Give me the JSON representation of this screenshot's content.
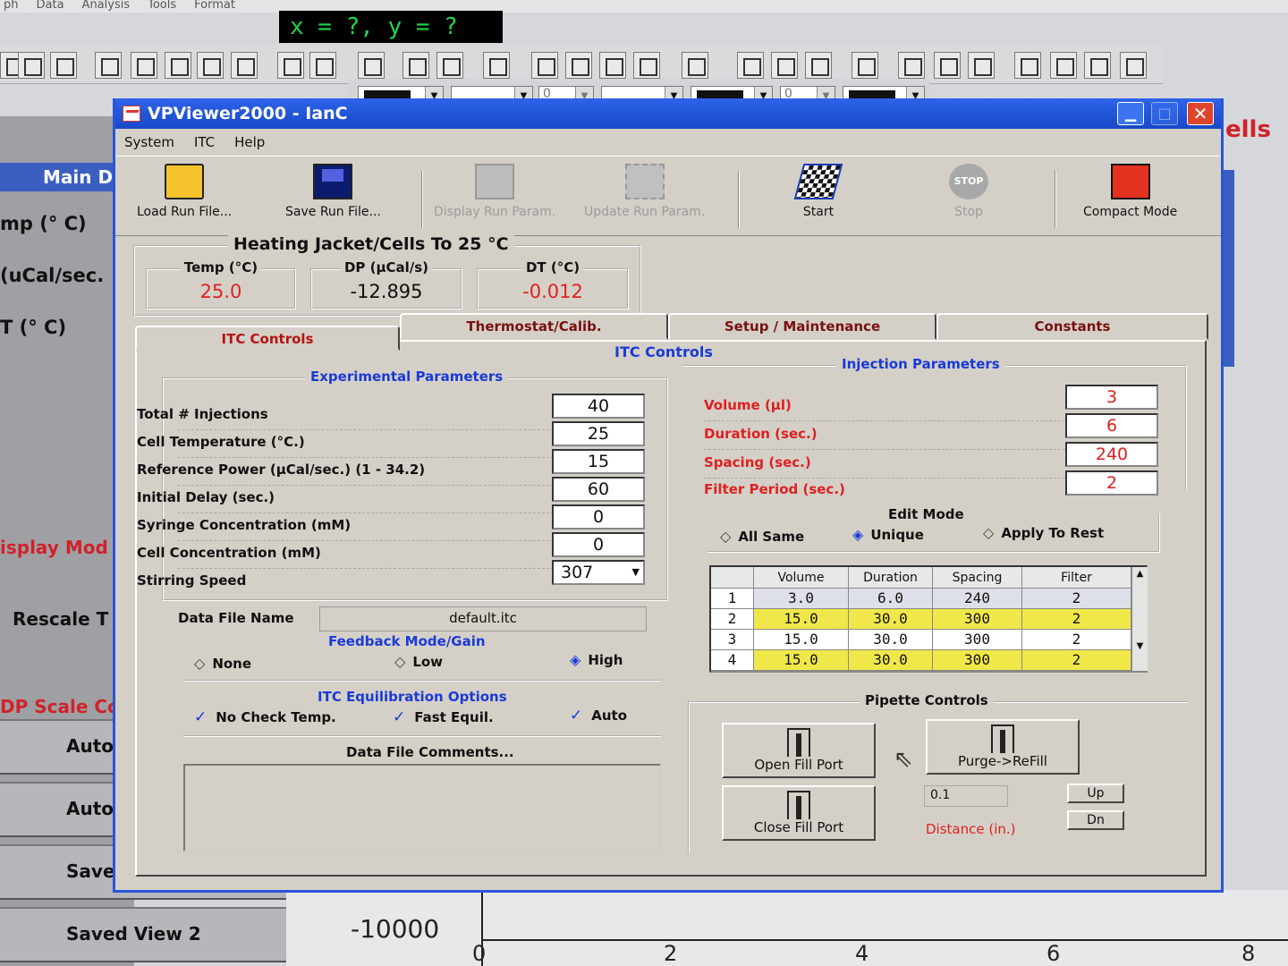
{
  "background": {
    "menu": [
      "ph",
      "Data",
      "Analysis",
      "Tools",
      "Format"
    ],
    "readout": "x = ?, y = ?",
    "side": {
      "header": "Main D",
      "labels": [
        "mp (° C)",
        "(uCal/sec.",
        "T (° C)"
      ],
      "display_mode": "isplay Mod",
      "rescale": "Rescale T",
      "dp_scale": "DP Scale Co",
      "buttons": [
        "Auto-",
        "Auto-",
        "Saved",
        "Saved View 2"
      ]
    },
    "right_title": "ells",
    "plot": {
      "y_value": "-10000",
      "x_ticks": [
        "0",
        "2",
        "4",
        "6",
        "8"
      ]
    },
    "combo_values": [
      "0",
      "0"
    ]
  },
  "window": {
    "title": "VPViewer2000 - IanC",
    "min": "▁",
    "max": "□",
    "close": "✕",
    "menu": [
      "System",
      "ITC",
      "Help"
    ],
    "tools": {
      "load": "Load Run File...",
      "save": "Save Run File...",
      "display": "Display Run Param.",
      "update": "Update Run Param.",
      "start": "Start",
      "stop": "Stop",
      "stop_icon": "STOP",
      "compact": "Compact Mode"
    },
    "status": {
      "title": "Heating Jacket/Cells To 25 °C",
      "temp_label": "Temp (°C)",
      "temp_value": "25.0",
      "dp_label": "DP (µCal/s)",
      "dp_value": "-12.895",
      "dt_label": "DT (°C)",
      "dt_value": "-0.012"
    },
    "tabs": [
      "ITC Controls",
      "Thermostat/Calib.",
      "Setup / Maintenance",
      "Constants"
    ],
    "panel_title": "ITC Controls",
    "experimental": {
      "title": "Experimental Parameters",
      "rows": [
        {
          "label": "Total # Injections",
          "value": "40"
        },
        {
          "label": "Cell Temperature (°C.)",
          "value": "25"
        },
        {
          "label": "Reference Power (µCal/sec.) (1 - 34.2)",
          "value": "15"
        },
        {
          "label": "Initial Delay (sec.)",
          "value": "60"
        },
        {
          "label": "Syringe Concentration (mM)",
          "value": "0"
        },
        {
          "label": "Cell Concentration (mM)",
          "value": "0"
        }
      ],
      "stirring_label": "Stirring Speed",
      "stirring_value": "307",
      "datafile_label": "Data File Name",
      "datafile_value": "default.itc"
    },
    "feedback": {
      "title": "Feedback Mode/Gain",
      "options": [
        "None",
        "Low",
        "High"
      ],
      "selected": "High"
    },
    "equil": {
      "title": "ITC Equilibration Options",
      "options": [
        "No Check Temp.",
        "Fast Equil.",
        "Auto"
      ],
      "check_mark": "✓"
    },
    "comments_label": "Data File Comments...",
    "injection": {
      "title": "Injection Parameters",
      "rows": [
        {
          "label": "Volume (µl)",
          "value": "3"
        },
        {
          "label": "Duration (sec.)",
          "value": "6"
        },
        {
          "label": "Spacing (sec.)",
          "value": "240"
        },
        {
          "label": "Filter Period (sec.)",
          "value": "2"
        }
      ]
    },
    "edit_mode": {
      "title": "Edit Mode",
      "options": [
        "All Same",
        "Unique",
        "Apply To Rest"
      ],
      "selected": "Unique"
    },
    "grid": {
      "headers": [
        "",
        "Volume",
        "Duration",
        "Spacing",
        "Filter"
      ],
      "rows": [
        [
          "1",
          "3.0",
          "6.0",
          "240",
          "2"
        ],
        [
          "2",
          "15.0",
          "30.0",
          "300",
          "2"
        ],
        [
          "3",
          "15.0",
          "30.0",
          "300",
          "2"
        ],
        [
          "4",
          "15.0",
          "30.0",
          "300",
          "2"
        ]
      ],
      "highlight_color": "#f0e84a"
    },
    "pipette": {
      "title": "Pipette Controls",
      "open": "Open Fill Port",
      "purge": "Purge->ReFill",
      "close": "Close Fill Port",
      "distance_value": "0.1",
      "distance_label": "Distance (in.)",
      "up": "Up",
      "dn": "Dn"
    }
  }
}
